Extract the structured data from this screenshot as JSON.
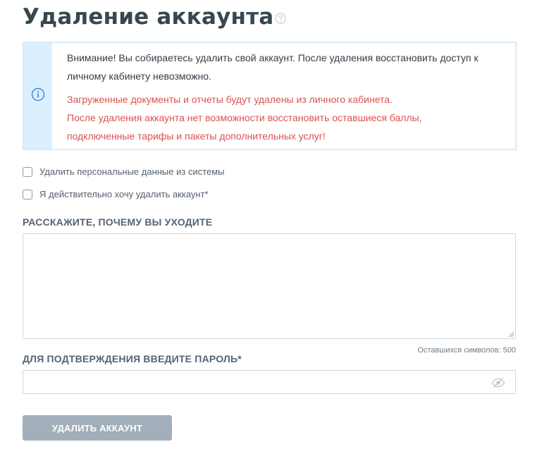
{
  "page": {
    "title": "Удаление аккаунта"
  },
  "alert": {
    "notice": "Внимание! Вы собираетесь удалить свой аккаунт. После удаления восстановить доступ к личному кабинету невозможно.",
    "warning_lines": [
      "Загруженные документы и отчеты будут удалены из личного кабинета.",
      "После удаления аккаунта нет возможности восстановить оставшиеся баллы,",
      "подключенные тарифы и пакеты дополнительных услуг!"
    ]
  },
  "options": {
    "delete_personal_data": {
      "label": "Удалить персональные данные из системы",
      "checked": false
    },
    "confirm_delete": {
      "label": "Я действительно хочу удалить аккаунт*",
      "checked": false
    }
  },
  "reason": {
    "label": "РАССКАЖИТЕ, ПОЧЕМУ ВЫ УХОДИТЕ",
    "value": "",
    "chars_left_text": "Оставшихся символов: 500"
  },
  "password": {
    "label": "ДЛЯ ПОДТВЕРЖДЕНИЯ ВВЕДИТЕ ПАРОЛЬ*",
    "value": ""
  },
  "actions": {
    "delete_label": "УДАЛИТЬ АККАУНТ"
  },
  "icons": {
    "help": "question-circle-icon",
    "info": "info-circle-icon",
    "eye": "eye-slash-icon"
  },
  "colors": {
    "title": "#37474f",
    "alert_side": "#dcefff",
    "alert_border": "#d6ebf8",
    "info_icon": "#3b8ed8",
    "warning_text": "#d9534f",
    "button_bg": "#a3aebb"
  }
}
